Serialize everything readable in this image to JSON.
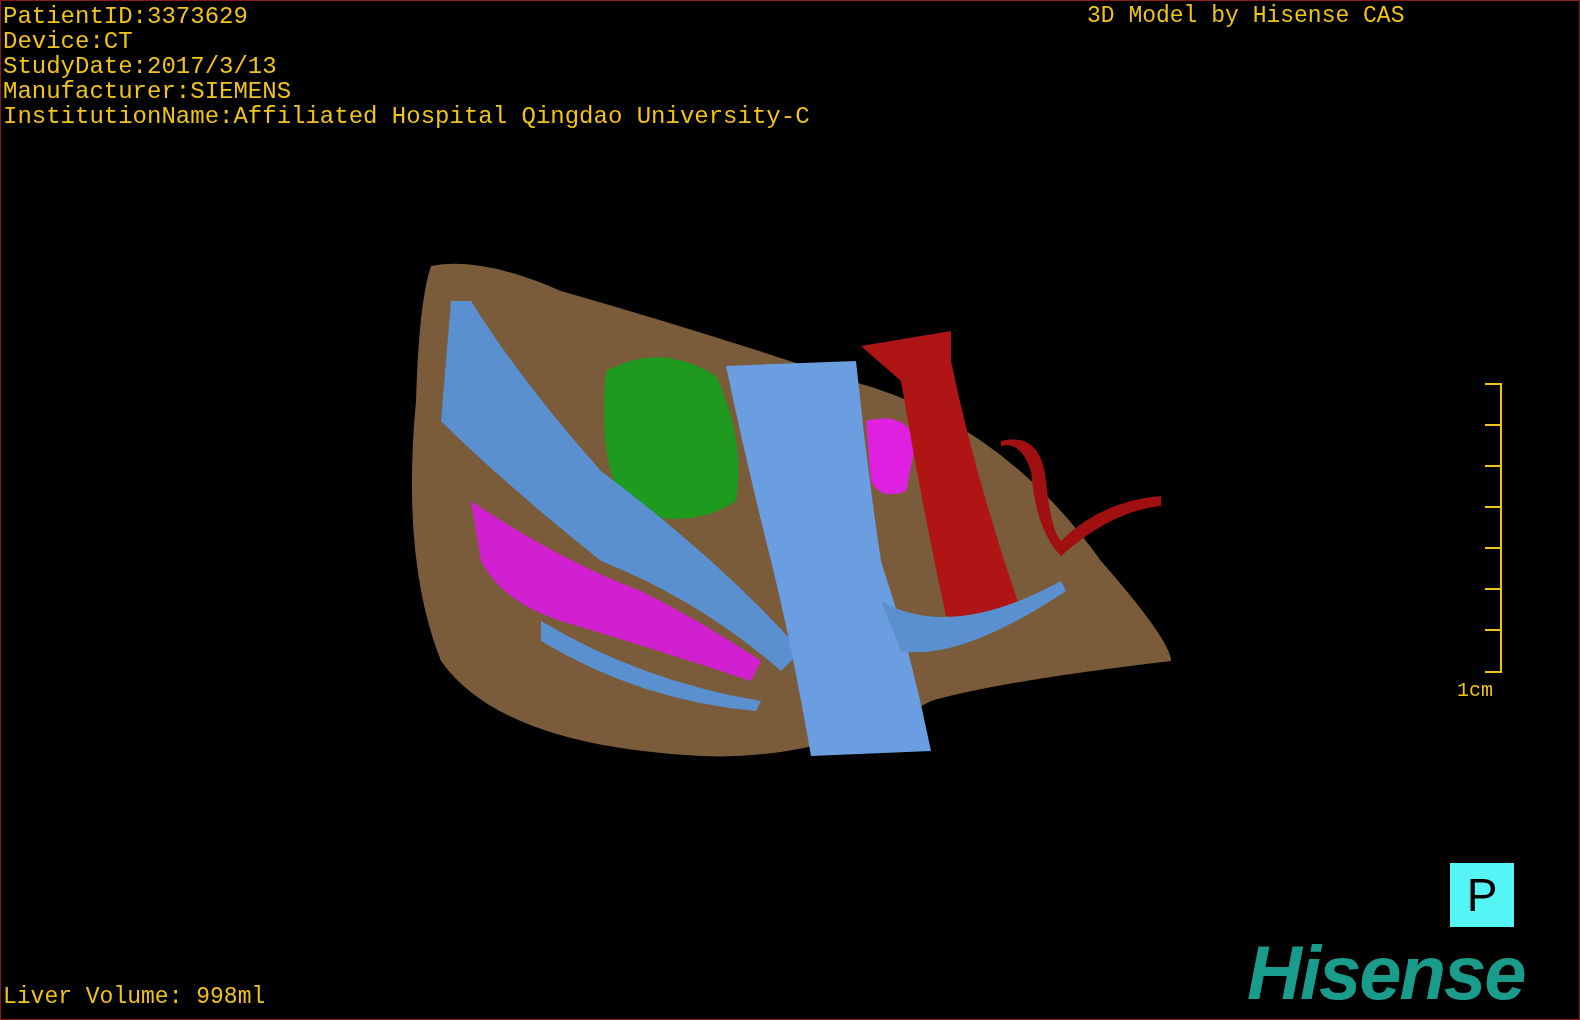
{
  "header_info": [
    "PatientID:3373629",
    "Device:CT",
    "StudyDate:2017/3/13",
    "Manufacturer:SIEMENS",
    "InstitutionName:Affiliated Hospital Qingdao University-C"
  ],
  "title": "3D Model by Hisense CAS",
  "scale_bar": {
    "label": "1cm"
  },
  "orientation_marker": "P",
  "logo": "Hisense",
  "liver_volume": "Liver Volume: 998ml"
}
